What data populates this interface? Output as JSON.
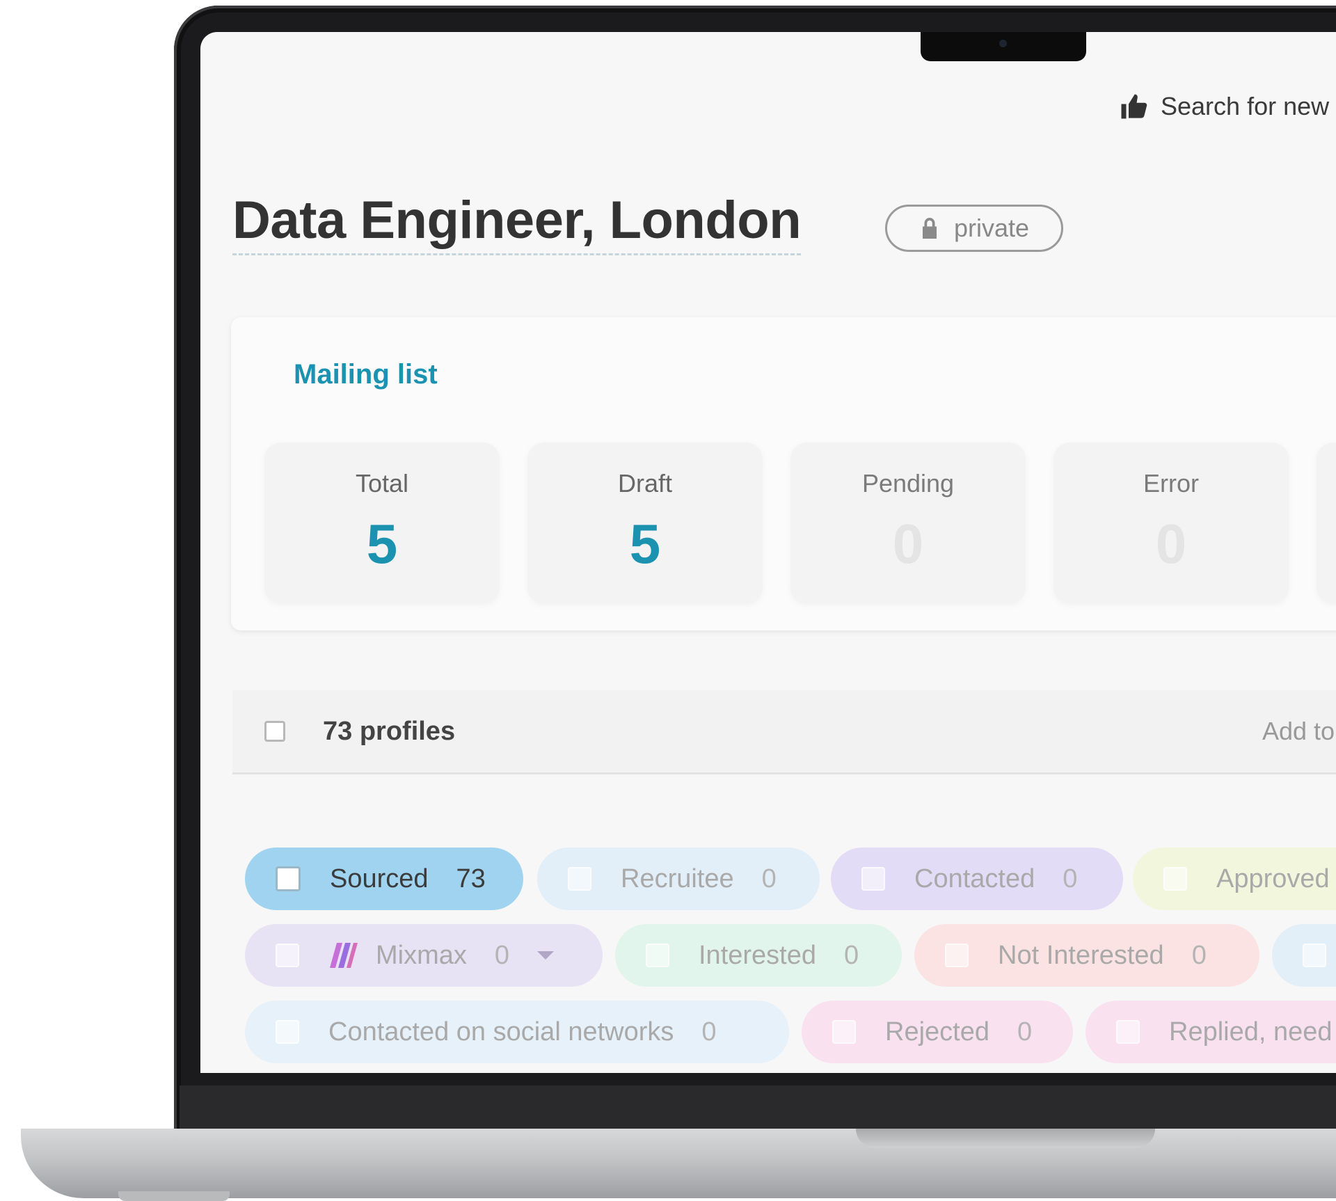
{
  "header": {
    "action_label": "Search for new",
    "action_icon": "thumbs-up-icon"
  },
  "page": {
    "title": "Data Engineer, London",
    "visibility_label": "private",
    "visibility_icon": "lock-icon"
  },
  "mailing_list": {
    "title": "Mailing list",
    "stats": [
      {
        "label": "Total",
        "value": "5"
      },
      {
        "label": "Draft",
        "value": "5"
      },
      {
        "label": "Pending",
        "value": "0"
      },
      {
        "label": "Error",
        "value": "0"
      }
    ]
  },
  "profiles": {
    "count_label": "73 profiles",
    "add_to_label": "Add to m"
  },
  "stages": [
    {
      "label": "Sourced",
      "count": "73",
      "color": "#9fd3ef",
      "active": true
    },
    {
      "label": "Recruitee",
      "count": "0",
      "color": "#e3eff8"
    },
    {
      "label": "Contacted",
      "count": "0",
      "color": "#e3dcf7"
    },
    {
      "label": "Approved",
      "count": "",
      "color": "#f2f6dd"
    },
    {
      "label": "Mixmax",
      "count": "0",
      "color": "#e8e2f5",
      "has_dropdown": true
    },
    {
      "label": "Interested",
      "count": "0",
      "color": "#e1f5ec"
    },
    {
      "label": "Not Interested",
      "count": "0",
      "color": "#fbe3e3"
    },
    {
      "label": "",
      "count": "",
      "color": "#e3eff8"
    },
    {
      "label": "Contacted on social networks",
      "count": "0",
      "color": "#e6f1f9"
    },
    {
      "label": "Rejected",
      "count": "0",
      "color": "#f9e1ef"
    },
    {
      "label": "Replied, need",
      "count": "",
      "color": "#f9e1ef"
    }
  ]
}
